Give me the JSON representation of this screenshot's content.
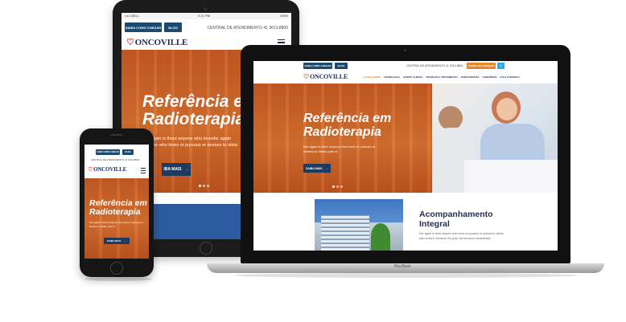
{
  "site": {
    "top_buttons": [
      "SAIBA COMO CHEGAR",
      "BLOG"
    ],
    "phone_line": "CENTRAL DE ATENDIMENTO 41 3013.8800",
    "trabalhe_label": "TRABALHE CONOSCO",
    "logo_text": "ONCOVILLE",
    "nav_items": [
      "QUEM SOMOS",
      "TECNOLOGIA",
      "CORPO CLÍNICO",
      "TÉCNICAS E TRATAMENTO",
      "RADIOTERAPIA",
      "CONVÊNIOS",
      "FALE CONOSCO"
    ],
    "hero_title_line1": "Referência em",
    "hero_title_line2": "Radioterapia",
    "hero_body": "Nor again is there anyone who loves or pursues or desires to obtain pain of",
    "cta_label": "SAIBA MAIS",
    "section_title_line1": "Acompanhamento",
    "section_title_line2": "Integral",
    "section_body": "Nor again is there anyone who loves or pursues or desires to obtain pain of itself, because it is pain, but because occasionally"
  },
  "tablet": {
    "status_carrier": "••••• BELL",
    "status_time": "4:21 PM",
    "status_battery": "100%",
    "hero_title_line1": "Referência e",
    "hero_title_line2": "Radioterapia",
    "hero_body_line1": "again is there anyone who lovesfor again",
    "hero_body_line2": "one who loves or pursues or desires to obtai",
    "cta_label": "IBA MAIS"
  },
  "laptop": {
    "brand_label": "MacBook"
  },
  "colors": {
    "accent_orange": "#d5672a",
    "navy": "#1e4a6d",
    "cta_navy": "#1e3a5f",
    "trabalhe_orange": "#e08a2c",
    "search_blue": "#2fa9e0"
  },
  "icons": [
    "hamburger-icon",
    "search-icon",
    "arrow-right-icon",
    "heart-logo-icon"
  ]
}
